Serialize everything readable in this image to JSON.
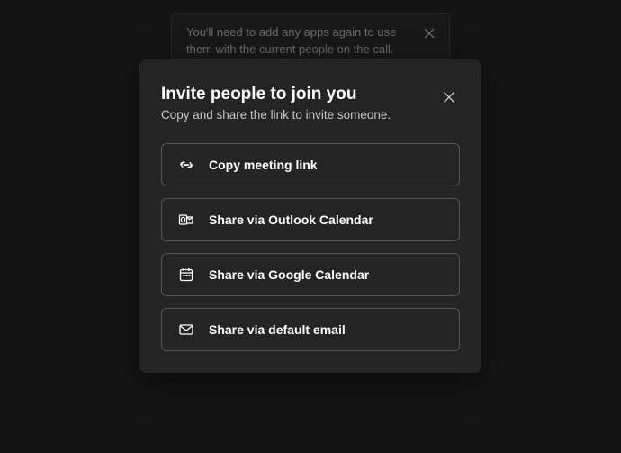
{
  "background": {
    "banner_text": "You'll need to add any apps again to use them with the current people on the call.",
    "faded_title": "Invite people to join you"
  },
  "modal": {
    "title": "Invite people to join you",
    "subtitle": "Copy and share the link to invite someone.",
    "options": [
      {
        "label": "Copy meeting link",
        "icon": "link-icon"
      },
      {
        "label": "Share via Outlook Calendar",
        "icon": "outlook-icon"
      },
      {
        "label": "Share via Google Calendar",
        "icon": "google-calendar-icon"
      },
      {
        "label": "Share via default email",
        "icon": "mail-icon"
      }
    ]
  }
}
